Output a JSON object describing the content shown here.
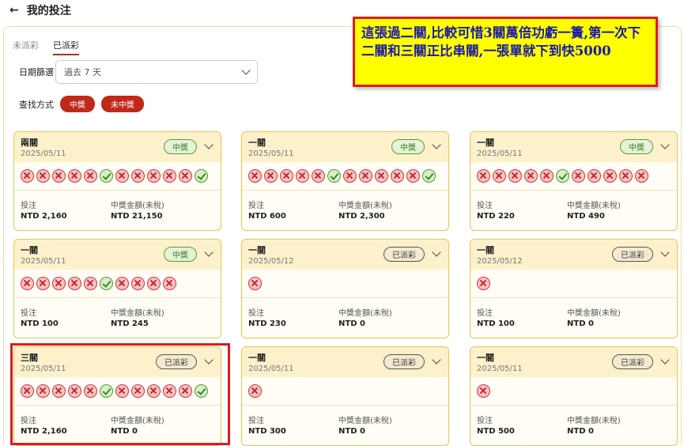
{
  "header": {
    "back_icon": "←",
    "title": "我的投注"
  },
  "tabs": [
    {
      "label": "未派彩",
      "active": false
    },
    {
      "label": "已派彩",
      "active": true
    }
  ],
  "filter": {
    "label": "日期篩選",
    "selected": "過去 7 天"
  },
  "search": {
    "label": "查找方式",
    "pills": [
      "中獎",
      "未中獎"
    ]
  },
  "labels": {
    "stake": "投注",
    "payout": "中獎金額(未稅)"
  },
  "annotation": "這張過二關,比較可惜3關萬倍功虧一簣,第一次下二關和三關正比串關,一張單就下到快5000",
  "cards": [
    {
      "title": "兩關",
      "date": "2025/05/11",
      "badge": "中獎",
      "status": "win",
      "icons": "xxxxxcxxxxxc",
      "stake": "NTD 2,160",
      "payout": "NTD 21,150"
    },
    {
      "title": "一關",
      "date": "2025/05/11",
      "badge": "中獎",
      "status": "win",
      "icons": "xxxxxcxxxxxc",
      "stake": "NTD 600",
      "payout": "NTD 2,300"
    },
    {
      "title": "一關",
      "date": "2025/05/11",
      "badge": "中獎",
      "status": "win",
      "icons": "xxxxxcxxxxx",
      "stake": "NTD 220",
      "payout": "NTD 490"
    },
    {
      "title": "一關",
      "date": "2025/05/11",
      "badge": "中獎",
      "status": "win",
      "icons": "xxxxxcxxxx",
      "stake": "NTD 100",
      "payout": "NTD 245"
    },
    {
      "title": "一關",
      "date": "2025/05/12",
      "badge": "已派彩",
      "status": "settled",
      "icons": "x",
      "stake": "NTD 230",
      "payout": "NTD 0"
    },
    {
      "title": "一關",
      "date": "2025/05/12",
      "badge": "已派彩",
      "status": "settled",
      "icons": "x",
      "stake": "NTD 100",
      "payout": "NTD 0"
    },
    {
      "title": "三關",
      "date": "2025/05/11",
      "badge": "已派彩",
      "status": "settled",
      "icons": "xxxxxcxxxxxc",
      "stake": "NTD 2,160",
      "payout": "NTD 0"
    },
    {
      "title": "一關",
      "date": "2025/05/11",
      "badge": "已派彩",
      "status": "settled",
      "icons": "x",
      "stake": "NTD 300",
      "payout": "NTD 0"
    },
    {
      "title": "一關",
      "date": "2025/05/11",
      "badge": "已派彩",
      "status": "settled",
      "icons": "x",
      "stake": "NTD 500",
      "payout": "NTD 0"
    }
  ]
}
